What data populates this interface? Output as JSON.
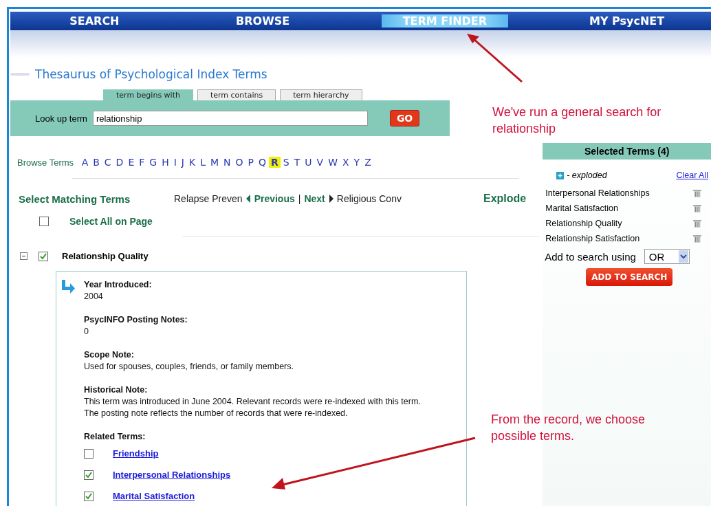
{
  "nav": [
    {
      "label": "SEARCH",
      "selected": false
    },
    {
      "label": "BROWSE",
      "selected": false
    },
    {
      "label": "TERM FINDER",
      "selected": true
    },
    {
      "label": "MY PsycNET",
      "selected": false
    }
  ],
  "title": "Thesaurus of Psychological Index Terms",
  "search_tabs": [
    {
      "label": "term begins with",
      "selected": true
    },
    {
      "label": "term contains",
      "selected": false
    },
    {
      "label": "term hierarchy",
      "selected": false
    }
  ],
  "lookup": {
    "label": "Look up term",
    "value": "relationship",
    "button": "GO"
  },
  "browse": {
    "label": "Browse Terms",
    "letters": [
      {
        "label": "A",
        "selected": false
      },
      {
        "label": "B",
        "selected": false
      },
      {
        "label": "C",
        "selected": false
      },
      {
        "label": "D",
        "selected": false
      },
      {
        "label": "E",
        "selected": false
      },
      {
        "label": "F",
        "selected": false
      },
      {
        "label": "G",
        "selected": false
      },
      {
        "label": "H",
        "selected": false
      },
      {
        "label": "I",
        "selected": false
      },
      {
        "label": "J",
        "selected": false
      },
      {
        "label": "K",
        "selected": false
      },
      {
        "label": "L",
        "selected": false
      },
      {
        "label": "M",
        "selected": false
      },
      {
        "label": "N",
        "selected": false
      },
      {
        "label": "O",
        "selected": false
      },
      {
        "label": "P",
        "selected": false
      },
      {
        "label": "Q",
        "selected": false
      },
      {
        "label": "R",
        "selected": true
      },
      {
        "label": "S",
        "selected": false
      },
      {
        "label": "T",
        "selected": false
      },
      {
        "label": "U",
        "selected": false
      },
      {
        "label": "V",
        "selected": false
      },
      {
        "label": "W",
        "selected": false
      },
      {
        "label": "X",
        "selected": false
      },
      {
        "label": "Y",
        "selected": false
      },
      {
        "label": "Z",
        "selected": false
      }
    ]
  },
  "matching": {
    "title": "Select Matching Terms",
    "prev_term": "Relapse Preven",
    "previous": "Previous",
    "separator": "|",
    "next": "Next",
    "next_term": "Religious Conv",
    "explode": "Explode"
  },
  "select_all": {
    "label": "Select All on Page",
    "checked": false
  },
  "term": {
    "name": "Relationship Quality",
    "checked": true,
    "expanded": true
  },
  "details": [
    {
      "heading": "Year Introduced:",
      "text": "2004"
    },
    {
      "heading": "PsycINFO Posting Notes:",
      "text": "0"
    },
    {
      "heading": "Scope Note:",
      "text": "Used for spouses, couples, friends, or family members."
    },
    {
      "heading": "Historical Note:",
      "text": "This term was introduced in June 2004. Relevant records were re-indexed with this term. The posting note reflects the number of records that were re-indexed."
    }
  ],
  "related": {
    "heading": "Related Terms:",
    "items": [
      {
        "label": "Friendship",
        "checked": false
      },
      {
        "label": "Interpersonal Relationships",
        "checked": true
      },
      {
        "label": "Marital Satisfaction",
        "checked": true
      }
    ]
  },
  "selected_panel": {
    "title": "Selected Terms (4)",
    "legend": "- exploded",
    "clear": "Clear All",
    "terms": [
      "Interpersonal Relationships",
      "Marital Satisfaction",
      "Relationship Quality",
      "Relationship Satisfaction"
    ],
    "combine_label": "Add to search using",
    "operator": "OR",
    "button": "ADD TO SEARCH"
  },
  "annotations": [
    "We've run a general search for relationship",
    "From the record, we choose possible terms."
  ]
}
